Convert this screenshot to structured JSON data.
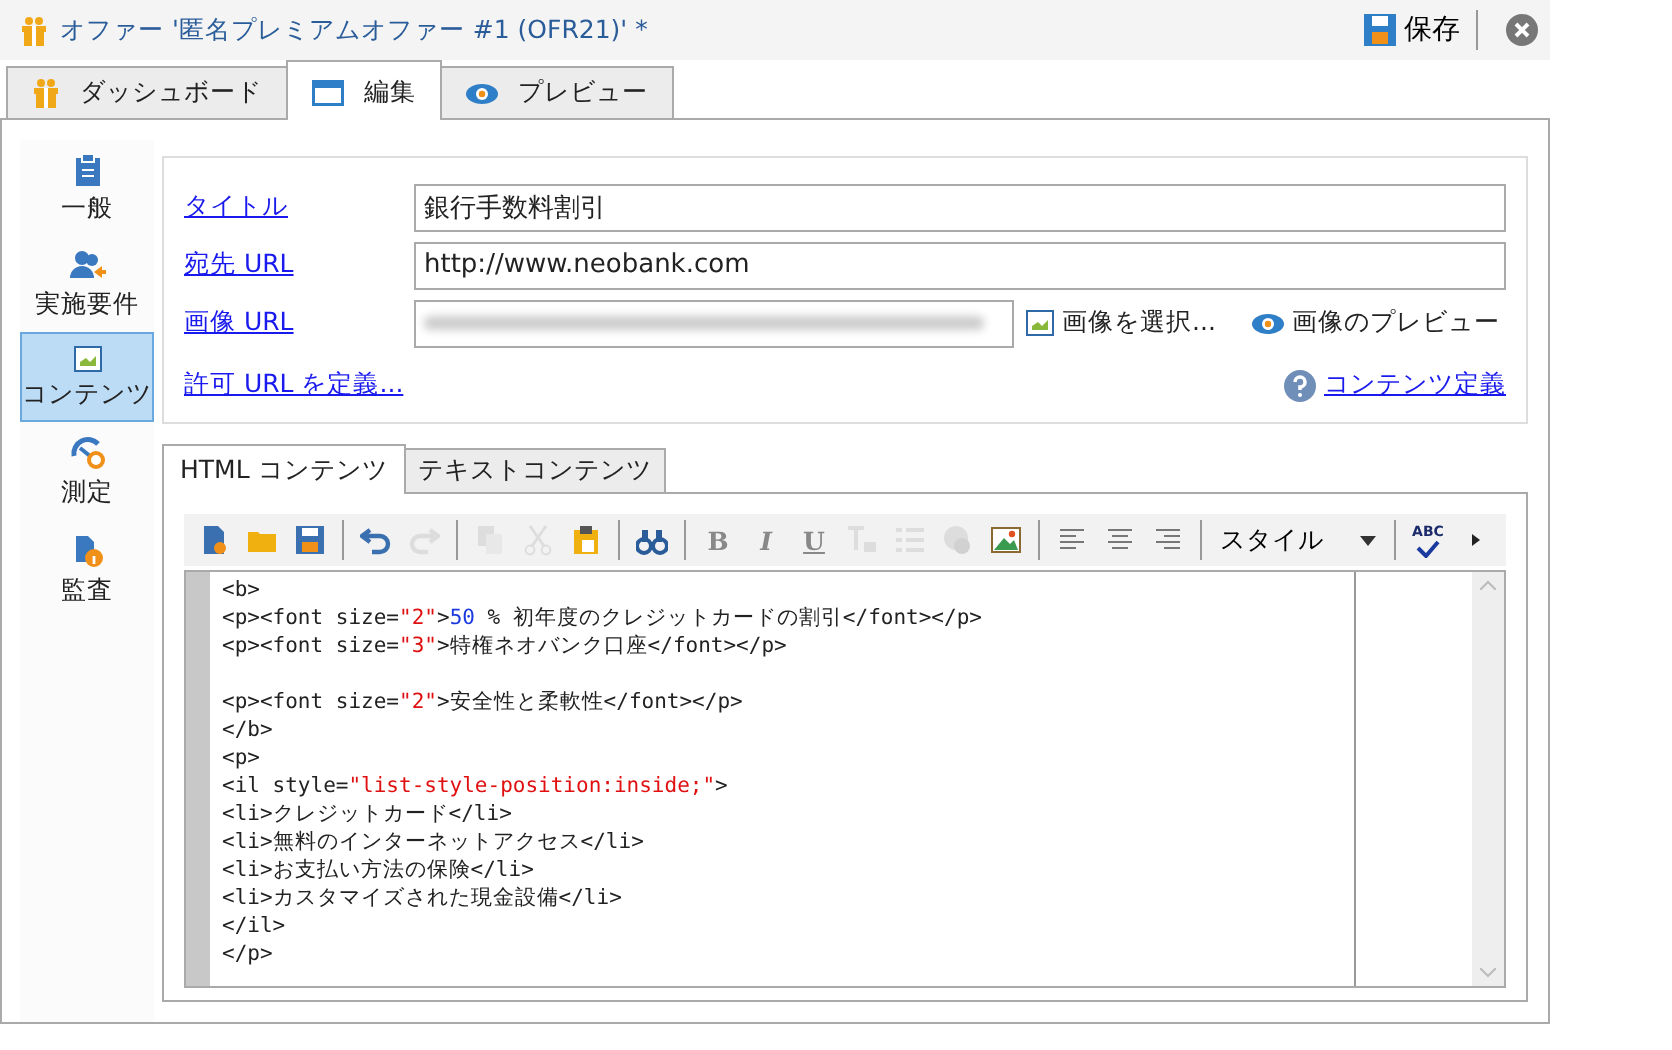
{
  "window": {
    "title": "オファー '匿名プレミアムオファー #1 (OFR21)' *",
    "save_label": "保存"
  },
  "tabs": [
    {
      "kind": "dashboard",
      "label": "ダッシュボード",
      "selected": false
    },
    {
      "kind": "edit",
      "label": "編集",
      "selected": true
    },
    {
      "kind": "preview",
      "label": "プレビュー",
      "selected": false
    }
  ],
  "sidebar": {
    "items": [
      {
        "kind": "general",
        "label": "一般",
        "selected": false
      },
      {
        "kind": "eligibility",
        "label": "実施要件",
        "selected": false
      },
      {
        "kind": "content",
        "label": "コンテンツ",
        "selected": true
      },
      {
        "kind": "measure",
        "label": "測定",
        "selected": false
      },
      {
        "kind": "audit",
        "label": "監査",
        "selected": false
      }
    ]
  },
  "form": {
    "fields": [
      {
        "label": "タイトル",
        "value": "銀行手数料割引"
      },
      {
        "label": "宛先 URL",
        "value": "http://www.neobank.com"
      },
      {
        "label": "画像 URL",
        "kind": "blurred"
      }
    ],
    "select_image": "画像を選択...",
    "preview_image": "画像のプレビュー",
    "allowed_urls_link": "許可 URL を定義...",
    "content_definition_link": "コンテンツ定義"
  },
  "editor_tabs": [
    {
      "label": "HTML コンテンツ",
      "selected": true
    },
    {
      "label": "テキストコンテンツ",
      "selected": false
    }
  ],
  "toolbar": [
    {
      "kind": "new",
      "disabled": false
    },
    {
      "kind": "open",
      "disabled": false
    },
    {
      "kind": "save",
      "disabled": false
    },
    {
      "kind": "separator"
    },
    {
      "kind": "undo",
      "disabled": false
    },
    {
      "kind": "redo",
      "disabled": true
    },
    {
      "kind": "separator"
    },
    {
      "kind": "copy",
      "disabled": true
    },
    {
      "kind": "cut",
      "disabled": true
    },
    {
      "kind": "paste",
      "disabled": false
    },
    {
      "kind": "separator"
    },
    {
      "kind": "find",
      "disabled": false
    },
    {
      "kind": "separator"
    },
    {
      "kind": "bold",
      "label": "B",
      "disabled": true
    },
    {
      "kind": "italic",
      "label": "I",
      "disabled": true
    },
    {
      "kind": "underline",
      "label": "U",
      "disabled": true
    },
    {
      "kind": "clear-format",
      "disabled": true
    },
    {
      "kind": "list",
      "disabled": true
    },
    {
      "kind": "link",
      "disabled": true
    },
    {
      "kind": "image",
      "disabled": false
    },
    {
      "kind": "separator"
    },
    {
      "kind": "align-left",
      "disabled": false
    },
    {
      "kind": "align-center",
      "disabled": false
    },
    {
      "kind": "align-right",
      "disabled": false
    },
    {
      "kind": "separator"
    },
    {
      "kind": "dropdown",
      "label": "スタイル"
    },
    {
      "kind": "separator"
    },
    {
      "kind": "spellcheck",
      "label": "ABC",
      "disabled": false
    },
    {
      "kind": "more",
      "disabled": false
    }
  ],
  "code_lines": [
    {
      "tokens": [
        {
          "kind": "tag",
          "text": "<b>"
        }
      ]
    },
    {
      "tokens": [
        {
          "kind": "tag",
          "text": "<p><font size="
        },
        {
          "kind": "string",
          "text": "\"2\""
        },
        {
          "kind": "tag",
          "text": ">"
        },
        {
          "kind": "number",
          "text": "50"
        },
        {
          "kind": "tag",
          "text": " % 初年度のクレジットカードの割引</font></p>"
        }
      ]
    },
    {
      "tokens": [
        {
          "kind": "tag",
          "text": "<p><font size="
        },
        {
          "kind": "string",
          "text": "\"3\""
        },
        {
          "kind": "tag",
          "text": ">特権ネオバンク口座</font></p>"
        }
      ]
    },
    {
      "kind": "blank"
    },
    {
      "tokens": [
        {
          "kind": "tag",
          "text": "<p><font size="
        },
        {
          "kind": "string",
          "text": "\"2\""
        },
        {
          "kind": "tag",
          "text": ">安全性と柔軟性</font></p>"
        }
      ]
    },
    {
      "tokens": [
        {
          "kind": "tag",
          "text": "</b>"
        }
      ]
    },
    {
      "tokens": [
        {
          "kind": "tag",
          "text": "<p>"
        }
      ]
    },
    {
      "tokens": [
        {
          "kind": "tag",
          "text": "<il style="
        },
        {
          "kind": "string",
          "text": "\"list-style-position:inside;\""
        },
        {
          "kind": "tag",
          "text": ">"
        }
      ]
    },
    {
      "tokens": [
        {
          "kind": "tag",
          "text": "<li>クレジットカード</li>"
        }
      ]
    },
    {
      "tokens": [
        {
          "kind": "tag",
          "text": "<li>無料のインターネットアクセス</li>"
        }
      ]
    },
    {
      "tokens": [
        {
          "kind": "tag",
          "text": "<li>お支払い方法の保険</li>"
        }
      ]
    },
    {
      "tokens": [
        {
          "kind": "tag",
          "text": "<li>カスタマイズされた現金設備</li>"
        }
      ]
    },
    {
      "tokens": [
        {
          "kind": "tag",
          "text": "</il>"
        }
      ]
    },
    {
      "tokens": [
        {
          "kind": "tag",
          "text": "</p>"
        }
      ]
    }
  ]
}
